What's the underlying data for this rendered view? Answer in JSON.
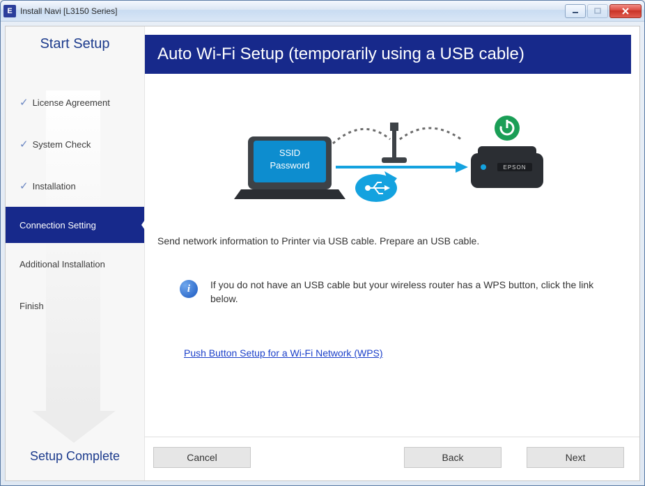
{
  "window": {
    "badge": "E",
    "title": "Install Navi [L3150 Series]"
  },
  "sidebar": {
    "top": "Start Setup",
    "bottom": "Setup Complete",
    "steps": [
      {
        "label": "License Agreement",
        "done": true
      },
      {
        "label": "System Check",
        "done": true
      },
      {
        "label": "Installation",
        "done": true
      },
      {
        "label": "Connection Setting",
        "active": true
      },
      {
        "label": "Additional Installation"
      },
      {
        "label": "Finish"
      }
    ]
  },
  "main": {
    "heading": "Auto Wi-Fi Setup (temporarily using a USB cable)",
    "diagram": {
      "ssid_label1": "SSID",
      "ssid_label2": "Password",
      "printer_brand": "EPSON"
    },
    "instruction": "Send network information to Printer via USB cable. Prepare an USB cable.",
    "info_text": "If you do not have an USB cable but your wireless router has a WPS button, click the link below.",
    "link_text": "Push Button Setup for a Wi-Fi Network (WPS)"
  },
  "buttons": {
    "cancel": "Cancel",
    "back": "Back",
    "next": "Next"
  }
}
